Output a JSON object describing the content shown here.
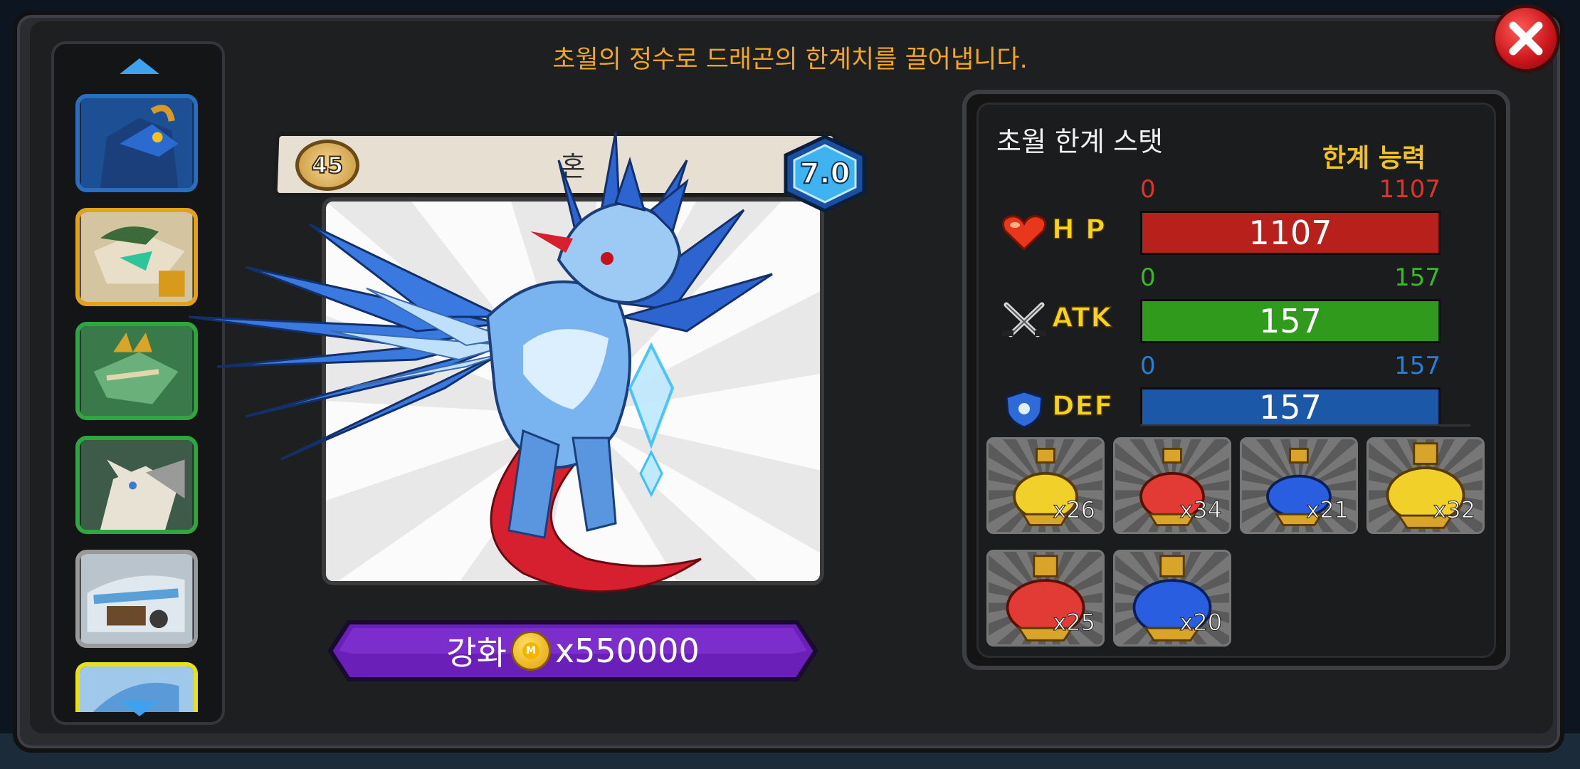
{
  "header": {
    "description": "초월의 정수로 드래곤의 한계치를 끌어냅니다."
  },
  "sidebar": {
    "items": [
      {
        "name": "dragon-thumb-1",
        "frame": "#2a6fbf"
      },
      {
        "name": "dragon-thumb-2",
        "frame": "#e2a21a"
      },
      {
        "name": "dragon-thumb-3",
        "frame": "#2fa641"
      },
      {
        "name": "dragon-thumb-4",
        "frame": "#2fa641"
      },
      {
        "name": "dragon-thumb-5",
        "frame": "#9a9a9a"
      },
      {
        "name": "dragon-thumb-6",
        "frame": "#e8e01a"
      }
    ]
  },
  "dragon": {
    "level": "45",
    "name": "혼",
    "grade": "7.0"
  },
  "enhance": {
    "label": "강화",
    "cost": "x550000"
  },
  "stats": {
    "title": "초월 한계 스탯",
    "limit_label": "한계 능력",
    "rows": [
      {
        "key": "hp",
        "label": "H P",
        "min": "0",
        "max": "1107",
        "value": "1107",
        "fill": 1.0,
        "bar_color": "#b8201c",
        "text_color": "#e0342a"
      },
      {
        "key": "atk",
        "label": "ATK",
        "min": "0",
        "max": "157",
        "value": "157",
        "fill": 1.0,
        "bar_color": "#2f9a1c",
        "text_color": "#3ab82a"
      },
      {
        "key": "def",
        "label": "DEF",
        "min": "0",
        "max": "157",
        "value": "157",
        "fill": 1.0,
        "bar_color": "#1c58a8",
        "text_color": "#2a7ed6"
      }
    ]
  },
  "potions": [
    {
      "type": "yellow-small",
      "qty": "x26",
      "color": "#f2d02a"
    },
    {
      "type": "red-small",
      "qty": "x34",
      "color": "#e23a34"
    },
    {
      "type": "blue-small",
      "qty": "x21",
      "color": "#2a5ee0"
    },
    {
      "type": "yellow-large",
      "qty": "x32",
      "color": "#f2d02a"
    },
    {
      "type": "red-large",
      "qty": "x25",
      "color": "#e23a34"
    },
    {
      "type": "blue-large",
      "qty": "x20",
      "color": "#2a5ee0"
    }
  ],
  "colors": {
    "accent": "#f4a71e",
    "enhance_button": "#6a1fb8",
    "panel_bg": "#1e1f21"
  }
}
